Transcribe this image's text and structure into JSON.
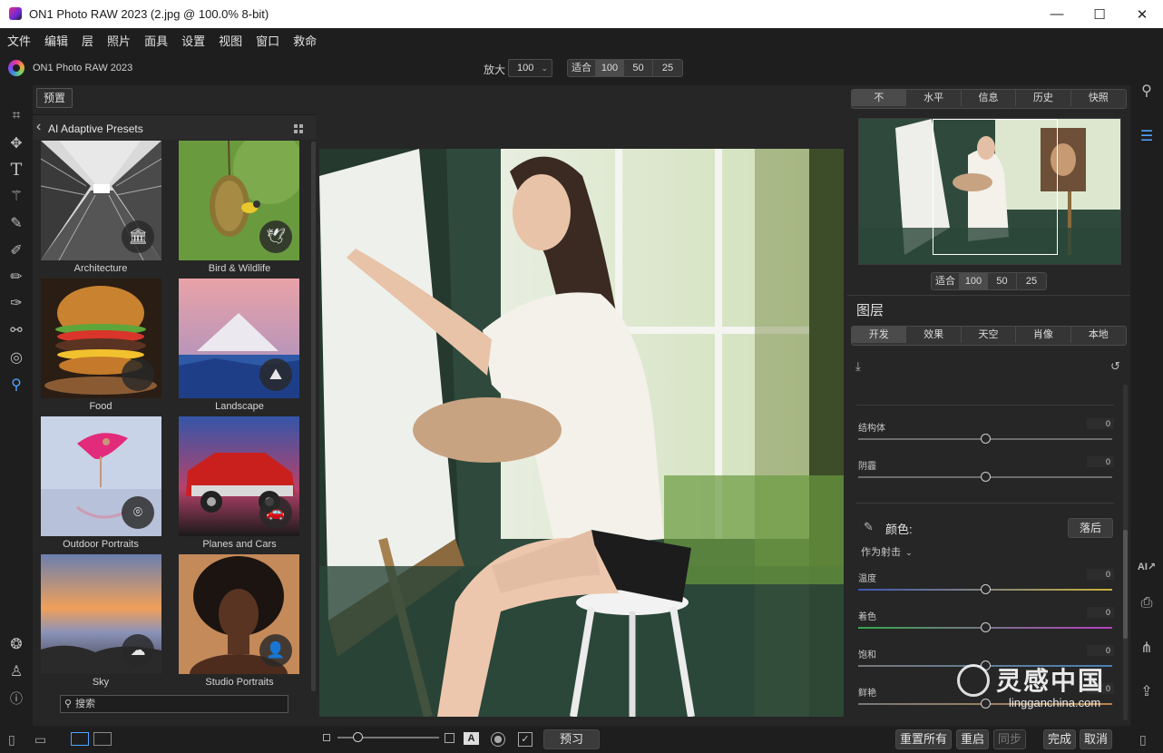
{
  "window": {
    "title": "ON1 Photo RAW 2023 (2.jpg @ 100.0% 8-bit)",
    "minimize": "—",
    "maximize": "☐",
    "close": "✕"
  },
  "menu": [
    "文件",
    "编辑",
    "层",
    "照片",
    "面具",
    "设置",
    "视图",
    "窗口",
    "救命"
  ],
  "topbar": {
    "app_name": "ON1 Photo RAW 2023",
    "zoom_label": "放大",
    "zoom_value": "100",
    "zoom_buttons": [
      "适合",
      "100",
      "50",
      "25"
    ]
  },
  "tools": [
    "crop-icon",
    "move-icon",
    "text-icon",
    "magic-wand-icon",
    "retouch-brush-icon",
    "adjust-brush-icon",
    "mask-brush-icon",
    "refine-brush-icon",
    "clone-icon",
    "fingerprint-icon",
    "view-icon",
    "layers-icon",
    "user-icon",
    "help-icon"
  ],
  "browser": {
    "presets_button": "预置",
    "category_title": "AI Adaptive Presets",
    "search_placeholder": "搜索",
    "presets": [
      {
        "label": "Architecture",
        "badge": "bank-icon"
      },
      {
        "label": "Bird & Wildlife",
        "badge": "bird-icon"
      },
      {
        "label": "Food",
        "badge": "apple-icon"
      },
      {
        "label": "Landscape",
        "badge": "mountain-icon"
      },
      {
        "label": "Outdoor Portraits",
        "badge": "location-pin-icon"
      },
      {
        "label": "Planes and Cars",
        "badge": "car-icon"
      },
      {
        "label": "Sky",
        "badge": "cloud-icon"
      },
      {
        "label": "Studio Portraits",
        "badge": "person-icon"
      }
    ]
  },
  "canvas": {
    "bottom_controls": {
      "preview_button": "预习",
      "text_mode": "A"
    }
  },
  "right_panel": {
    "tabs": [
      "不",
      "水平",
      "信息",
      "历史",
      "快照"
    ],
    "nav_zoom_buttons": [
      "适合",
      "100",
      "50",
      "25"
    ],
    "layers_title": "图层",
    "layer_tabs": [
      "开发",
      "效果",
      "天空",
      "肖像",
      "本地"
    ],
    "sliders_top": [
      {
        "label": "结构体",
        "value": "0",
        "position": 0.5
      },
      {
        "label": "阴霾",
        "value": "0",
        "position": 0.5
      }
    ],
    "color_section": {
      "title": "颜色:",
      "reset_button": "落后",
      "mode_label": "作为射击"
    },
    "sliders_color": [
      {
        "label": "温度",
        "value": "0",
        "position": 0.5
      },
      {
        "label": "着色",
        "value": "0",
        "position": 0.5
      },
      {
        "label": "饱和",
        "value": "0",
        "position": 0.5
      },
      {
        "label": "鲜艳",
        "value": "0",
        "position": 0.5
      }
    ]
  },
  "bottombar": {
    "reset_all": "重置所有",
    "reset": "重启",
    "sync": "同步",
    "done": "完成",
    "cancel": "取消"
  },
  "watermark": {
    "text": "灵感中国",
    "url": "lingganchina.com"
  }
}
